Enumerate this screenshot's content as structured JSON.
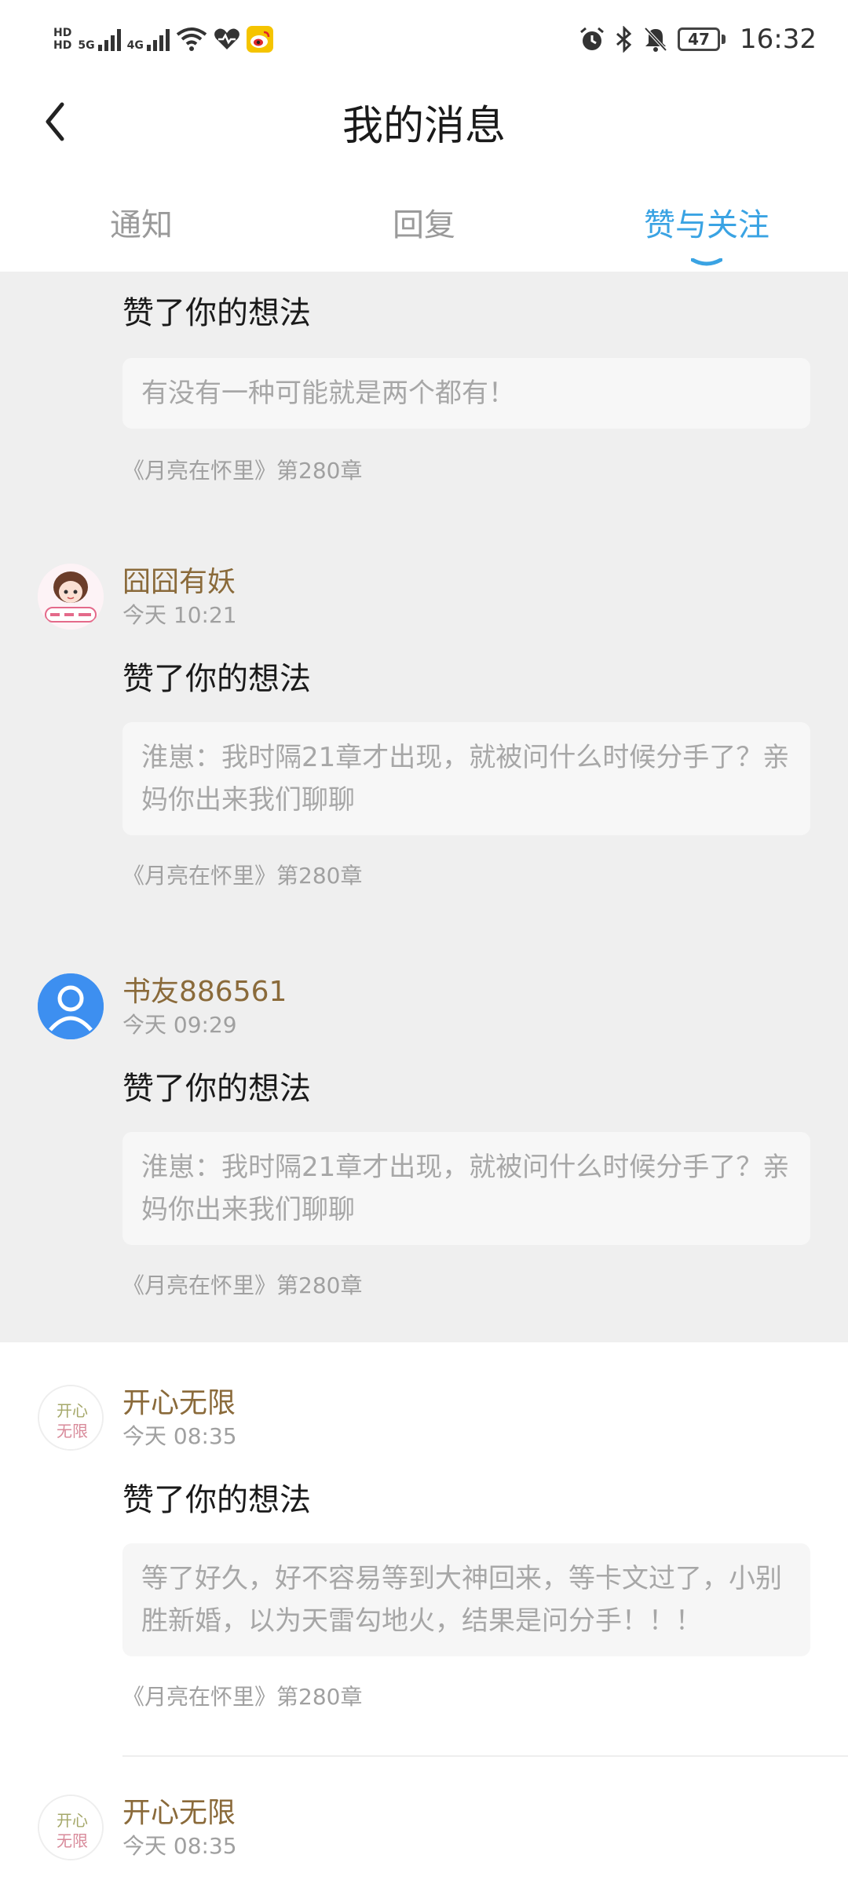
{
  "status_bar": {
    "left_labels": {
      "hd1": "HD",
      "hd2": "HD",
      "net1": "5G",
      "net2": "4G"
    },
    "battery": "47",
    "time": "16:32"
  },
  "header": {
    "title": "我的消息"
  },
  "tabs": [
    {
      "label": "通知",
      "active": false
    },
    {
      "label": "回复",
      "active": false
    },
    {
      "label": "赞与关注",
      "active": true
    }
  ],
  "feed": [
    {
      "user": "",
      "time": "",
      "action": "赞了你的想法",
      "quote": "有没有一种可能就是两个都有！",
      "source": "《月亮在怀里》第280章"
    },
    {
      "user": "囧囧有妖",
      "time": "今天 10:21",
      "action": "赞了你的想法",
      "quote": "淮崽：我时隔21章才出现，就被问什么时候分手了？亲妈你出来我们聊聊",
      "source": "《月亮在怀里》第280章"
    },
    {
      "user": "书友886561",
      "time": "今天 09:29",
      "action": "赞了你的想法",
      "quote": "淮崽：我时隔21章才出现，就被问什么时候分手了？亲妈你出来我们聊聊",
      "source": "《月亮在怀里》第280章"
    },
    {
      "user": "开心无限",
      "time": "今天 08:35",
      "action": "赞了你的想法",
      "quote": "等了好久，好不容易等到大神回来，等卡文过了，小别胜新婚，以为天雷勾地火，结果是问分手！！！",
      "source": "《月亮在怀里》第280章"
    },
    {
      "user": "开心无限",
      "time": "今天 08:35",
      "action": "",
      "quote": "",
      "source": ""
    }
  ],
  "avatar_texts": {
    "happy_top": "开心",
    "happy_bottom": "无限"
  },
  "colors": {
    "accent": "#3aa3e3",
    "username": "#8a6a3a",
    "band": "#efefef"
  }
}
